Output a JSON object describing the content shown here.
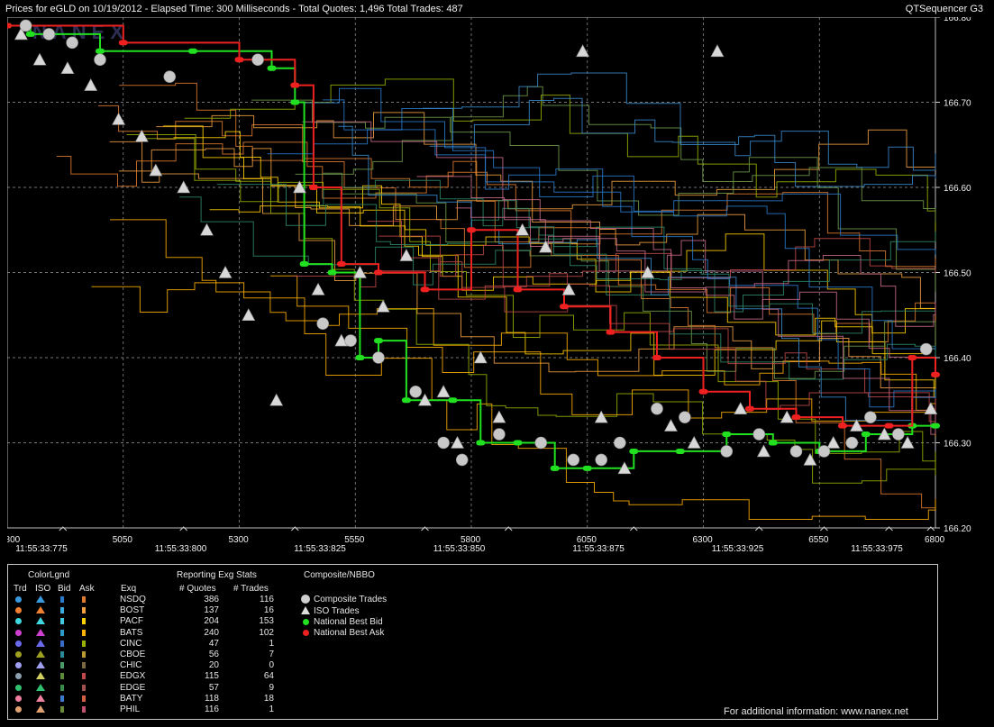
{
  "header": {
    "title": "Prices for  eGLD  on  10/19/2012  -  Elapsed Time: 300 Milliseconds  -  Total Quotes: 1,496  Total Trades: 487",
    "app": "QTSequencer G3"
  },
  "chart_data": {
    "type": "line",
    "x_range": [
      4800,
      6800
    ],
    "y_range": [
      166.2,
      166.8
    ],
    "y_ticks": [
      "166.80",
      "166.70",
      "166.60",
      "166.50",
      "166.40",
      "166.30",
      "166.20"
    ],
    "x_ticks": [
      "4800",
      "5050",
      "5300",
      "5550",
      "5800",
      "6050",
      "6300",
      "6550",
      "6800"
    ],
    "time_ticks": [
      "11:55:33:775",
      "11:55:33:800",
      "11:55:33:825",
      "11:55:33:850",
      "11:55:33:875",
      "11:55:33:925",
      "11:55:33:975"
    ],
    "grid": true,
    "watermark": "NANEX",
    "series": [
      {
        "name": "NSDQ",
        "color": "#e07a2e"
      },
      {
        "name": "BOST",
        "color": "#f0a040"
      },
      {
        "name": "PACF",
        "color": "#ffd000"
      },
      {
        "name": "BATS",
        "color": "#ffb000"
      },
      {
        "name": "CINC",
        "color": "#9ab000"
      },
      {
        "name": "CBOE",
        "color": "#6e9a4a"
      },
      {
        "name": "CHIC",
        "color": "#2e8a6a"
      },
      {
        "name": "EDGX",
        "color": "#c04848"
      },
      {
        "name": "EDGE",
        "color": "#2a7acb"
      },
      {
        "name": "BATY",
        "color": "#3a8acb"
      },
      {
        "name": "PHIL",
        "color": "#c86a8a"
      }
    ],
    "national_best_bid": [
      [
        4800,
        166.79
      ],
      [
        4850,
        166.78
      ],
      [
        5000,
        166.76
      ],
      [
        5200,
        166.76
      ],
      [
        5370,
        166.74
      ],
      [
        5420,
        166.7
      ],
      [
        5440,
        166.51
      ],
      [
        5500,
        166.5
      ],
      [
        5560,
        166.4
      ],
      [
        5600,
        166.42
      ],
      [
        5660,
        166.35
      ],
      [
        5760,
        166.35
      ],
      [
        5820,
        166.3
      ],
      [
        5900,
        166.3
      ],
      [
        5980,
        166.27
      ],
      [
        6050,
        166.27
      ],
      [
        6150,
        166.29
      ],
      [
        6250,
        166.29
      ],
      [
        6350,
        166.31
      ],
      [
        6450,
        166.3
      ],
      [
        6550,
        166.29
      ],
      [
        6650,
        166.31
      ],
      [
        6750,
        166.32
      ],
      [
        6800,
        166.32
      ]
    ],
    "national_best_ask": [
      [
        4800,
        166.79
      ],
      [
        5050,
        166.77
      ],
      [
        5300,
        166.75
      ],
      [
        5420,
        166.72
      ],
      [
        5460,
        166.6
      ],
      [
        5520,
        166.51
      ],
      [
        5600,
        166.5
      ],
      [
        5700,
        166.48
      ],
      [
        5800,
        166.55
      ],
      [
        5900,
        166.48
      ],
      [
        6000,
        166.46
      ],
      [
        6100,
        166.43
      ],
      [
        6200,
        166.4
      ],
      [
        6300,
        166.36
      ],
      [
        6400,
        166.34
      ],
      [
        6500,
        166.33
      ],
      [
        6600,
        166.32
      ],
      [
        6700,
        166.32
      ],
      [
        6750,
        166.4
      ],
      [
        6800,
        166.38
      ]
    ],
    "iso_trades": [
      [
        4830,
        166.78
      ],
      [
        4870,
        166.75
      ],
      [
        4930,
        166.74
      ],
      [
        4980,
        166.72
      ],
      [
        5040,
        166.68
      ],
      [
        5090,
        166.66
      ],
      [
        5120,
        166.62
      ],
      [
        5180,
        166.6
      ],
      [
        5230,
        166.55
      ],
      [
        5270,
        166.5
      ],
      [
        5320,
        166.45
      ],
      [
        5380,
        166.35
      ],
      [
        5430,
        166.6
      ],
      [
        5470,
        166.48
      ],
      [
        5520,
        166.42
      ],
      [
        5560,
        166.5
      ],
      [
        5610,
        166.46
      ],
      [
        5660,
        166.52
      ],
      [
        5700,
        166.35
      ],
      [
        5740,
        166.36
      ],
      [
        5770,
        166.3
      ],
      [
        5820,
        166.4
      ],
      [
        5860,
        166.33
      ],
      [
        5910,
        166.55
      ],
      [
        5960,
        166.53
      ],
      [
        6010,
        166.48
      ],
      [
        6040,
        166.76
      ],
      [
        6080,
        166.33
      ],
      [
        6130,
        166.27
      ],
      [
        6180,
        166.5
      ],
      [
        6230,
        166.32
      ],
      [
        6280,
        166.3
      ],
      [
        6330,
        166.76
      ],
      [
        6380,
        166.34
      ],
      [
        6430,
        166.29
      ],
      [
        6480,
        166.33
      ],
      [
        6530,
        166.28
      ],
      [
        6580,
        166.3
      ],
      [
        6630,
        166.32
      ],
      [
        6690,
        166.31
      ],
      [
        6740,
        166.3
      ],
      [
        6790,
        166.34
      ]
    ],
    "composite_trades": [
      [
        4840,
        166.79
      ],
      [
        4890,
        166.78
      ],
      [
        4940,
        166.77
      ],
      [
        5000,
        166.75
      ],
      [
        5150,
        166.73
      ],
      [
        5340,
        166.75
      ],
      [
        5480,
        166.44
      ],
      [
        5540,
        166.42
      ],
      [
        5600,
        166.4
      ],
      [
        5680,
        166.36
      ],
      [
        5740,
        166.3
      ],
      [
        5780,
        166.28
      ],
      [
        5860,
        166.31
      ],
      [
        5950,
        166.3
      ],
      [
        6020,
        166.28
      ],
      [
        6080,
        166.28
      ],
      [
        6120,
        166.3
      ],
      [
        6200,
        166.34
      ],
      [
        6260,
        166.33
      ],
      [
        6350,
        166.29
      ],
      [
        6420,
        166.31
      ],
      [
        6500,
        166.29
      ],
      [
        6560,
        166.29
      ],
      [
        6620,
        166.3
      ],
      [
        6660,
        166.33
      ],
      [
        6720,
        166.31
      ],
      [
        6780,
        166.41
      ]
    ]
  },
  "legend": {
    "color_title": "ColorLgnd",
    "col_headers": [
      "Trd",
      "ISO",
      "Bid",
      "Ask",
      "Exq"
    ],
    "stats_title": "Reporting Exg Stats",
    "stats_headers": [
      "# Quotes",
      "# Trades"
    ],
    "composite_title": "Composite/NBBO",
    "composite_items": [
      "Composite Trades",
      "ISO Trades",
      "National Best Bid",
      "National Best Ask"
    ],
    "rows": [
      {
        "exg": "NSDQ",
        "quotes": "386",
        "trades": "116",
        "trd": "#3a9adf",
        "iso": "#3a9adf",
        "bid": "#2a7acb",
        "ask": "#e07a2e"
      },
      {
        "exg": "BOST",
        "quotes": "137",
        "trades": "16",
        "trd": "#f08030",
        "iso": "#f08030",
        "bid": "#3aaadf",
        "ask": "#f0a040"
      },
      {
        "exg": "PACF",
        "quotes": "204",
        "trades": "153",
        "trd": "#40d8e0",
        "iso": "#40d8e0",
        "bid": "#40c8e0",
        "ask": "#ffd000"
      },
      {
        "exg": "BATS",
        "quotes": "240",
        "trades": "102",
        "trd": "#d040d0",
        "iso": "#d040d0",
        "bid": "#2a9acb",
        "ask": "#ffb000"
      },
      {
        "exg": "CINC",
        "quotes": "47",
        "trades": "1",
        "trd": "#6a6aef",
        "iso": "#6a6aef",
        "bid": "#3a6acb",
        "ask": "#9ab000"
      },
      {
        "exg": "CBOE",
        "quotes": "56",
        "trades": "7",
        "trd": "#a0a020",
        "iso": "#a0a020",
        "bid": "#2a8a9a",
        "ask": "#b89a30"
      },
      {
        "exg": "CHIC",
        "quotes": "20",
        "trades": "0",
        "trd": "#a0a0f0",
        "iso": "#a0a0f0",
        "bid": "#4a9a6a",
        "ask": "#7a6a40"
      },
      {
        "exg": "EDGX",
        "quotes": "115",
        "trades": "64",
        "trd": "#8aa0b0",
        "iso": "#d0d060",
        "bid": "#5a8a3a",
        "ask": "#c04848"
      },
      {
        "exg": "EDGE",
        "quotes": "57",
        "trades": "9",
        "trd": "#30c070",
        "iso": "#30c070",
        "bid": "#3a8a4a",
        "ask": "#a05050"
      },
      {
        "exg": "BATY",
        "quotes": "118",
        "trades": "18",
        "trd": "#f080a0",
        "iso": "#f080a0",
        "bid": "#3a7acb",
        "ask": "#d06040"
      },
      {
        "exg": "PHIL",
        "quotes": "116",
        "trades": "1",
        "trd": "#e0a070",
        "iso": "#e0a070",
        "bid": "#6a8a3a",
        "ask": "#c05070"
      }
    ],
    "footer": "For additional information: www.nanex.net"
  }
}
